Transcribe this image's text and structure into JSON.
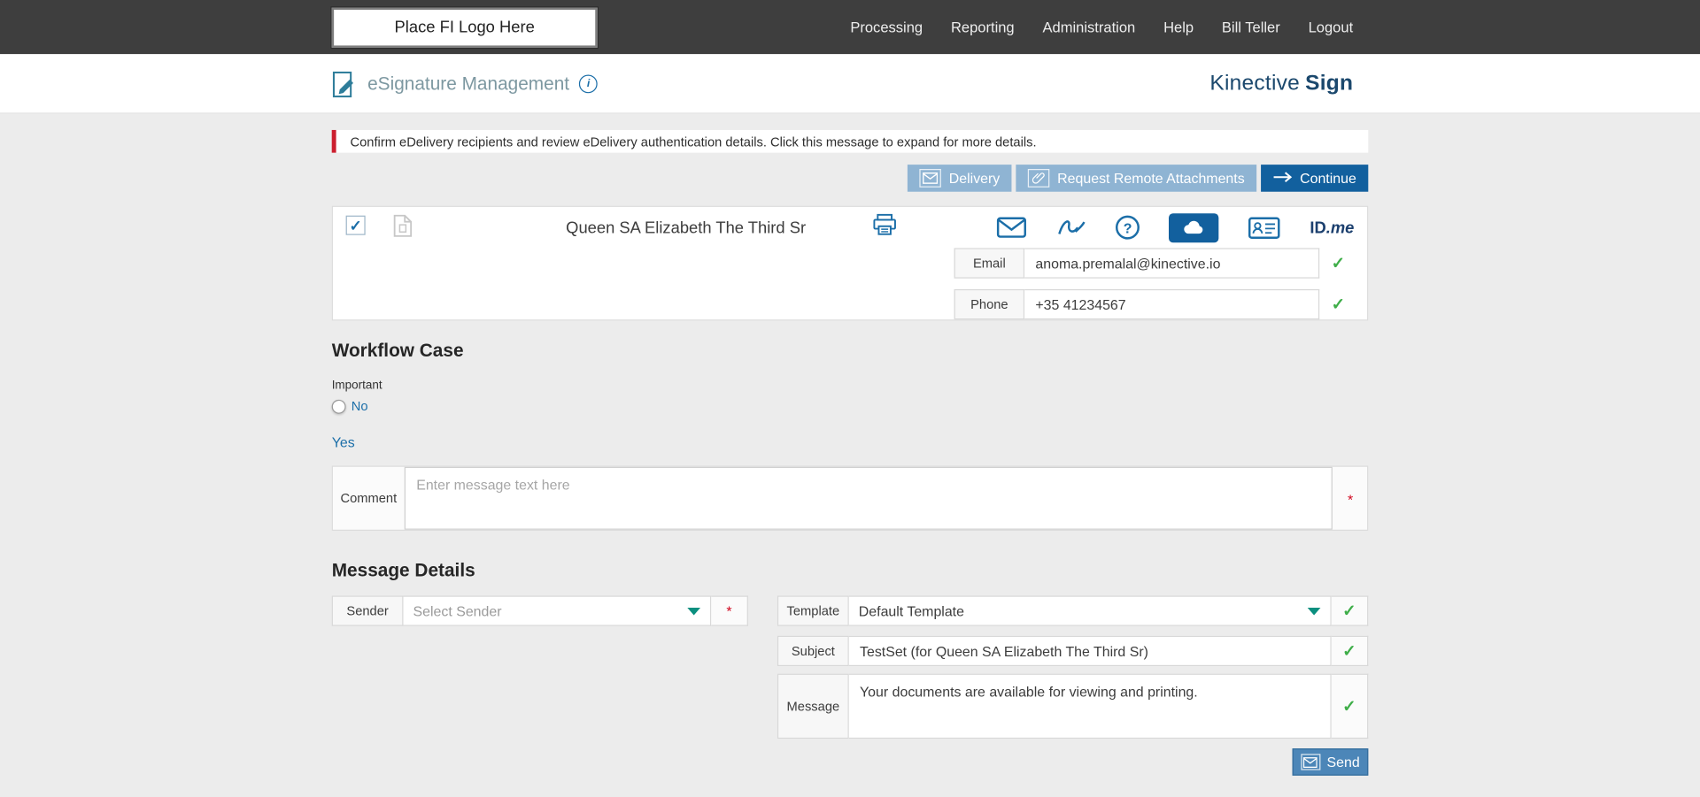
{
  "topbar": {
    "logo_placeholder": "Place FI Logo Here",
    "nav": [
      "Processing",
      "Reporting",
      "Administration",
      "Help",
      "Bill Teller",
      "Logout"
    ]
  },
  "header": {
    "title": "eSignature Management",
    "brand_name": "Kinective",
    "brand_suffix": "Sign"
  },
  "alert": {
    "message": "Confirm eDelivery recipients and review eDelivery authentication details. Click this message to expand for more details."
  },
  "toolbar": {
    "delivery_label": "Delivery",
    "request_remote_label": "Request Remote Attachments",
    "continue_label": "Continue"
  },
  "recipient": {
    "name": "Queen SA Elizabeth The Third Sr",
    "email_label": "Email",
    "email_value": "anoma.premalal@kinective.io",
    "phone_label": "Phone",
    "phone_value": "+35 41234567",
    "idme_prefix": "ID",
    "idme_suffix": ".me"
  },
  "workflow": {
    "heading": "Workflow Case",
    "field_label": "Important",
    "option_no": "No",
    "option_yes": "Yes",
    "comment_label": "Comment",
    "comment_placeholder": "Enter message text here"
  },
  "message_details": {
    "heading": "Message Details",
    "sender_label": "Sender",
    "sender_placeholder": "Select Sender",
    "template_label": "Template",
    "template_value": "Default Template",
    "subject_label": "Subject",
    "subject_value": "TestSet (for Queen SA Elizabeth The Third Sr)",
    "message_label": "Message",
    "message_value": "Your documents are available for viewing and printing.",
    "send_label": "Send"
  },
  "glyphs": {
    "info": "i",
    "question": "?",
    "check": "✓",
    "required": "*"
  },
  "colors": {
    "topbar_bg": "#3e3e3e",
    "page_bg": "#ececec",
    "accent_blue": "#12609e",
    "light_blue": "#8fb4d3",
    "brand_navy": "#1b486d",
    "alert_red": "#cc1f2f",
    "success_green": "#3fae49",
    "dropdown_teal": "#0b8f7f"
  }
}
